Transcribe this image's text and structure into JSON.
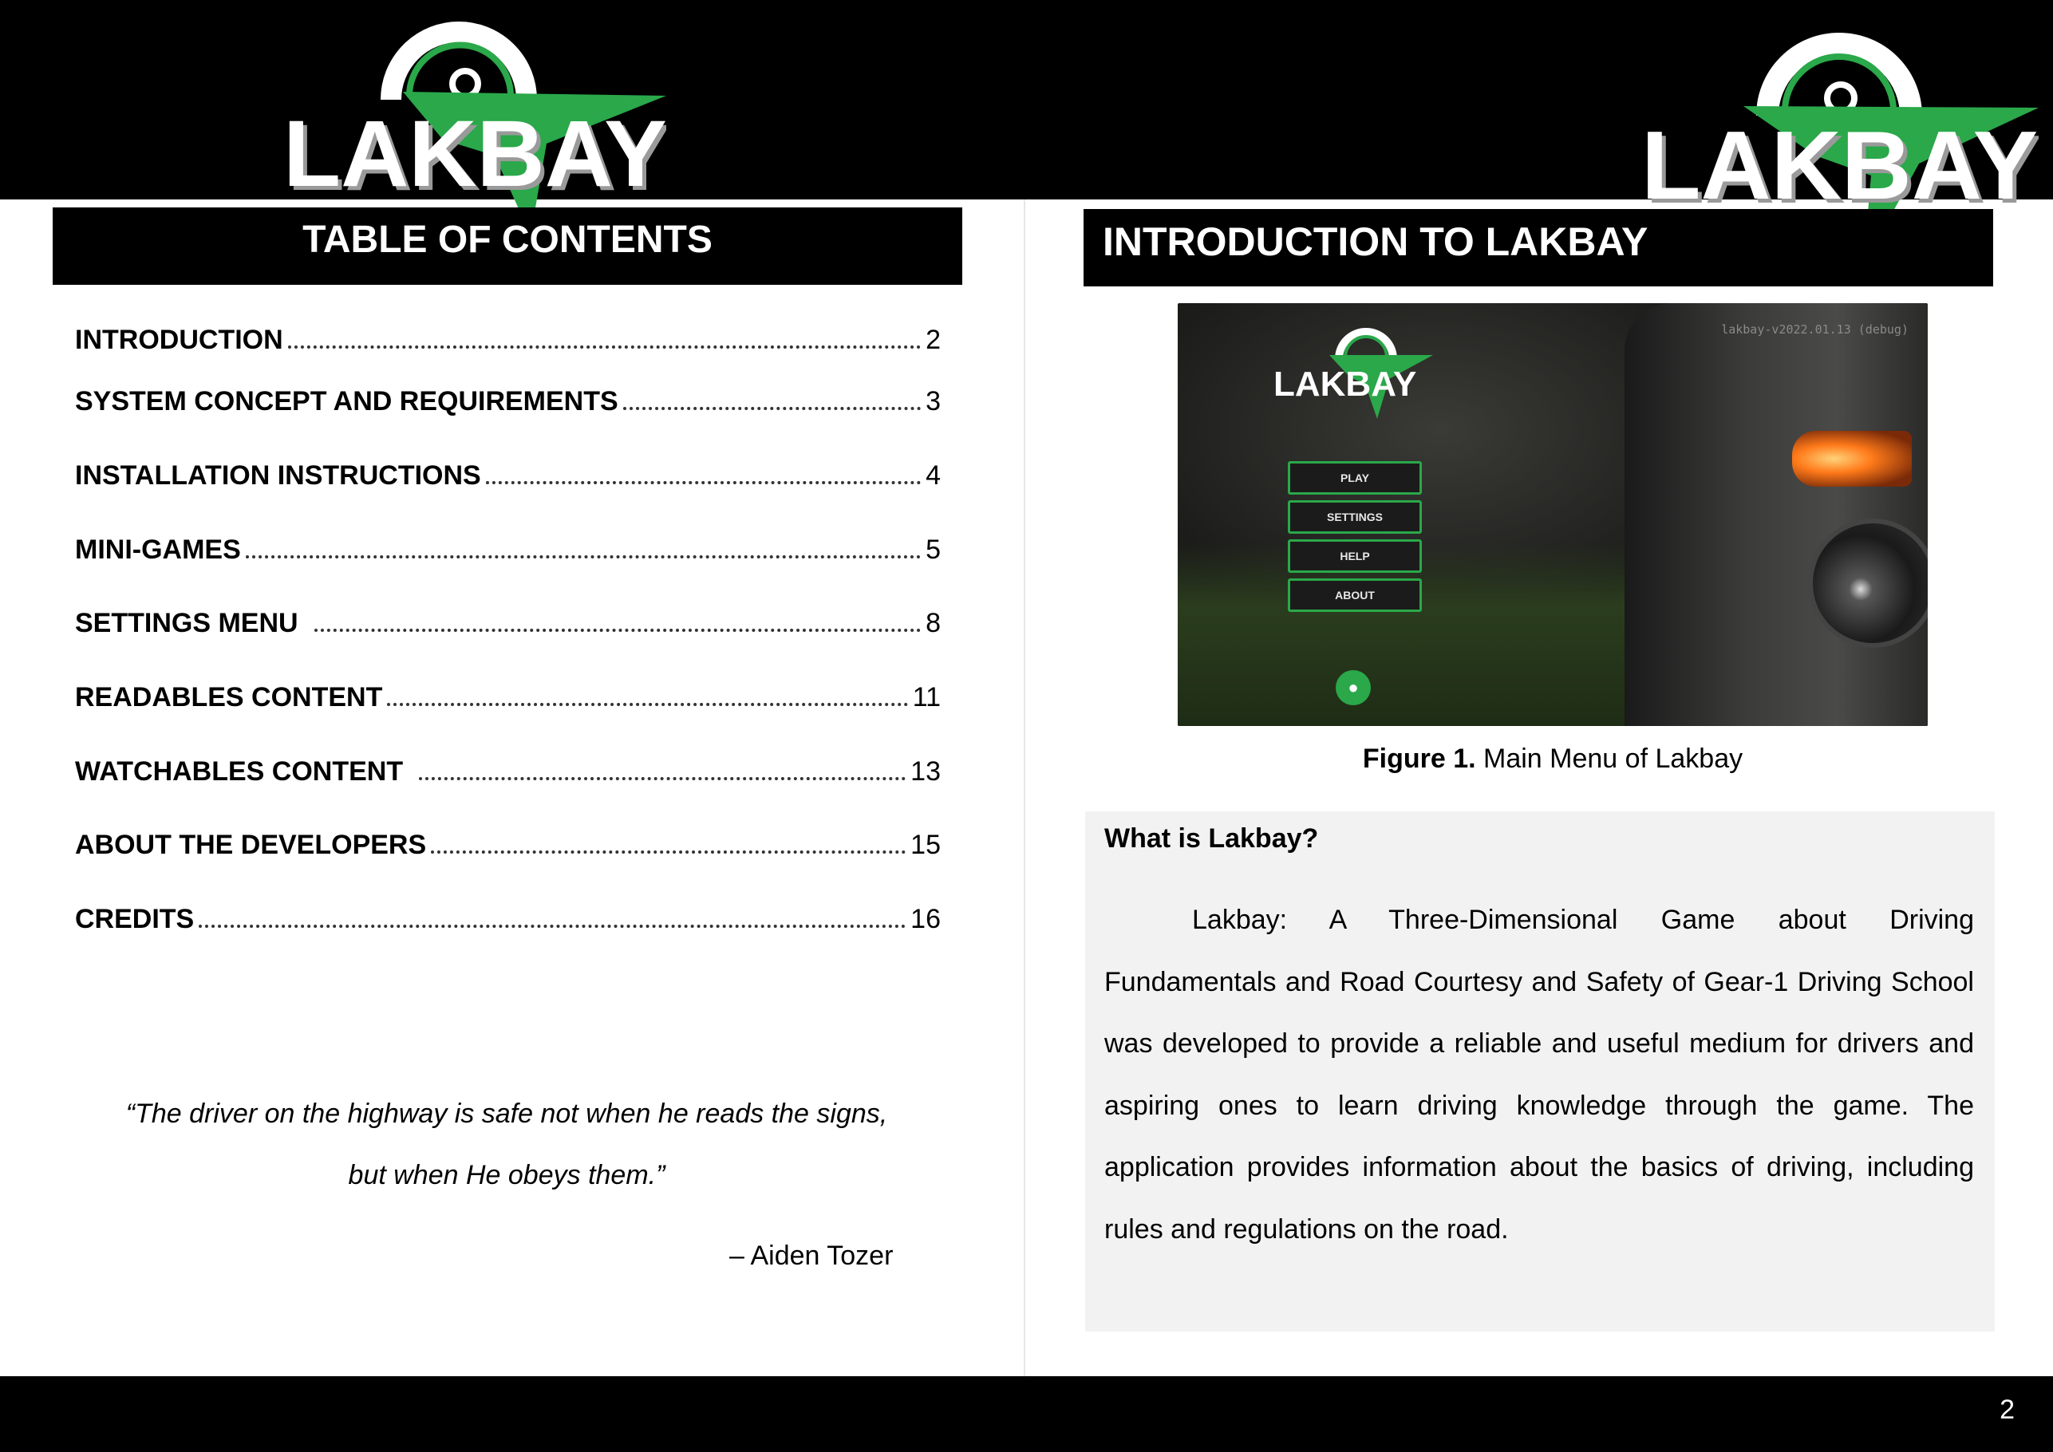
{
  "header": {
    "logo_text_left": "LAKBAY",
    "logo_text_right": "LAKBAY",
    "brand_green": "#2aa84a"
  },
  "left_page": {
    "title": "TABLE OF CONTENTS",
    "toc": [
      {
        "label": "INTRODUCTION",
        "page": "2"
      },
      {
        "label": "SYSTEM CONCEPT AND REQUIREMENTS",
        "page": "3"
      },
      {
        "label": "INSTALLATION INSTRUCTIONS",
        "page": "4"
      },
      {
        "label": "MINI-GAMES",
        "page": "5"
      },
      {
        "label": "SETTINGS MENU",
        "page": "8"
      },
      {
        "label": "READABLES CONTENT",
        "page": "11"
      },
      {
        "label": "WATCHABLES CONTENT",
        "page": "13"
      },
      {
        "label": "ABOUT THE DEVELOPERS",
        "page": "15"
      },
      {
        "label": "CREDITS",
        "page": "16"
      }
    ],
    "quote_line1": "“The driver on the highway is safe not when he reads the signs,",
    "quote_line2": "but when He obeys them.”",
    "quote_author": "– Aiden Tozer"
  },
  "right_page": {
    "title": "INTRODUCTION TO LAKBAY",
    "screenshot": {
      "version": "lakbay-v2022.01.13 (debug)",
      "logo_text": "LAKBAY",
      "menu": [
        "PLAY",
        "SETTINGS",
        "HELP",
        "ABOUT"
      ],
      "bulb_icon": "lightbulb-icon"
    },
    "caption_bold": "Figure 1.",
    "caption_text": " Main Menu of Lakbay",
    "box_heading": "What is Lakbay?",
    "box_paragraph": "Lakbay: A Three-Dimensional Game about Driving Fundamentals and Road Courtesy and Safety of Gear-1 Driving School was developed to provide a reliable and useful medium for drivers and aspiring ones to learn driving knowledge through the game. The application provides information about the basics of driving, including rules and regulations on the road."
  },
  "footer": {
    "page_number": "2"
  }
}
